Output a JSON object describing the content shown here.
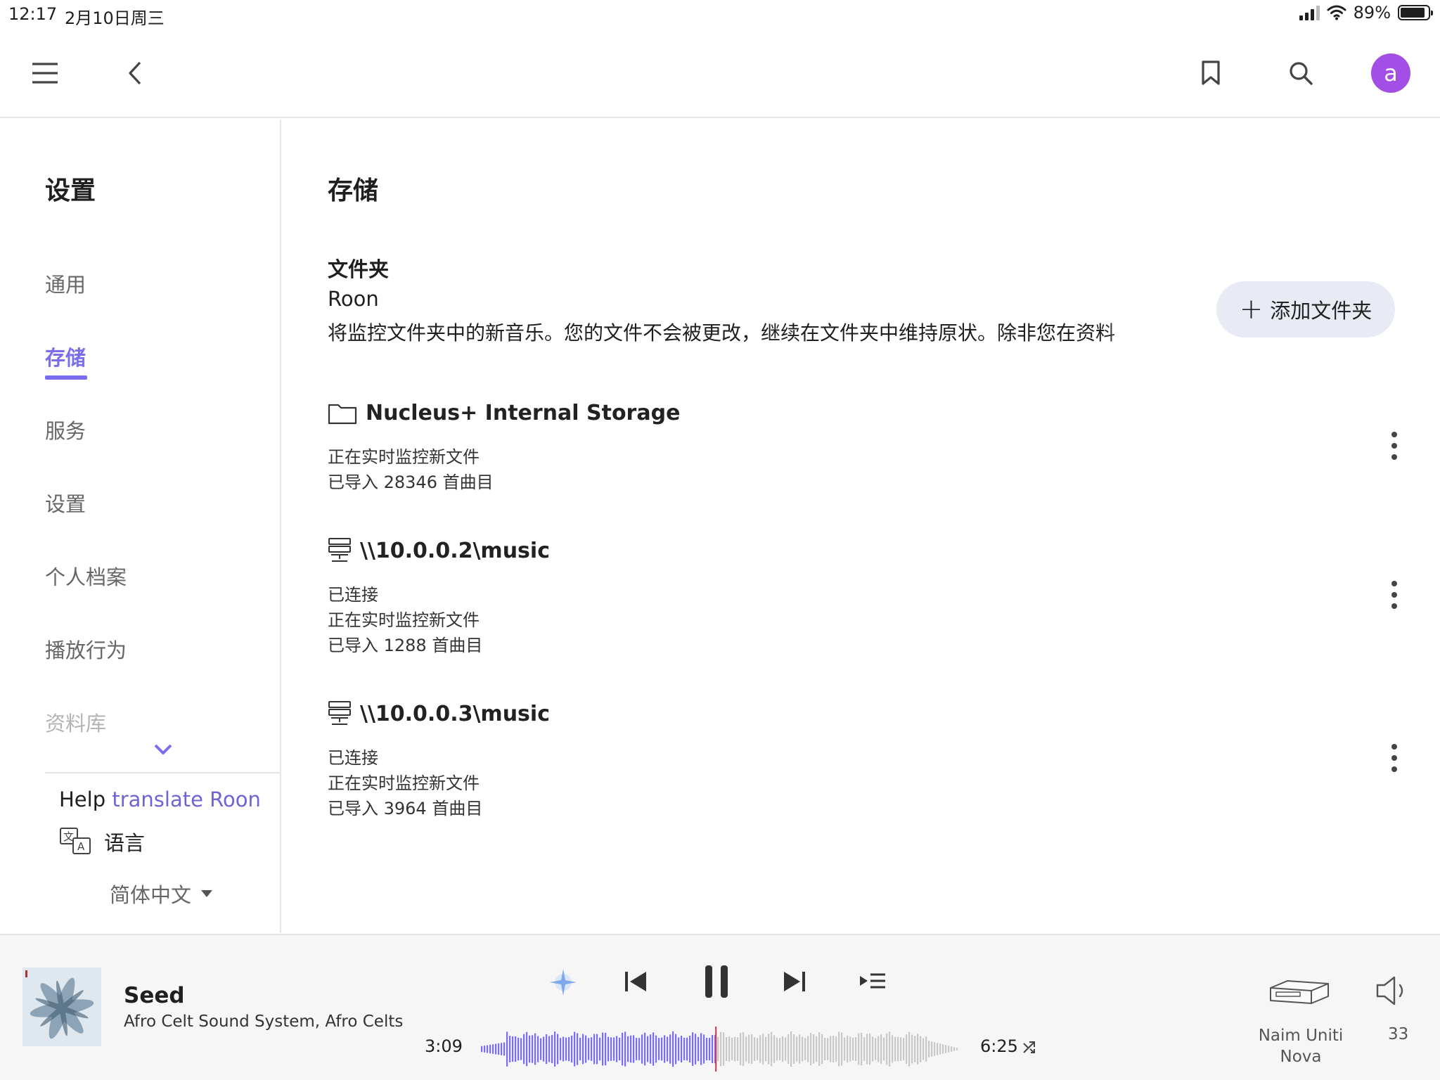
{
  "status_bar": {
    "time": "12:17",
    "date": "2月10日周三",
    "battery": "89%"
  },
  "top_nav": {
    "avatar_letter": "a"
  },
  "sidebar": {
    "title": "设置",
    "items": [
      {
        "label": "通用"
      },
      {
        "label": "存储"
      },
      {
        "label": "服务"
      },
      {
        "label": "设置"
      },
      {
        "label": "个人档案"
      },
      {
        "label": "播放行为"
      },
      {
        "label": "资料库"
      }
    ],
    "active_index": 1,
    "help_text": "Help",
    "help_link": "translate Roon",
    "language_label": "语言",
    "language_value": "简体中文"
  },
  "main": {
    "title": "存储",
    "folder_heading": "文件夹",
    "folder_sub": "Roon",
    "folder_desc": "将监控文件夹中的新音乐。您的文件不会被更改，继续在文件夹中维持原状。除非您在资料",
    "add_folder_label": "添加文件夹",
    "storages": [
      {
        "name": "Nucleus+ Internal Storage",
        "icon": "folder-icon",
        "lines": [
          "正在实时监控新文件",
          "已导入 28346 首曲目"
        ]
      },
      {
        "name": "\\\\10.0.0.2\\music",
        "icon": "network-drive-icon",
        "lines": [
          "已连接",
          "正在实时监控新文件",
          "已导入 1288 首曲目"
        ]
      },
      {
        "name": "\\\\10.0.0.3\\music",
        "icon": "network-drive-icon",
        "lines": [
          "已连接",
          "正在实时监控新文件",
          "已导入 3964 首曲目"
        ]
      }
    ]
  },
  "player": {
    "track_title": "Seed",
    "track_artist": "Afro Celt Sound System, Afro Celts",
    "time_elapsed": "3:09",
    "time_total": "6:25",
    "progress_fraction": 0.49,
    "zone_name": "Naim Uniti Nova",
    "volume": "33",
    "accent_color": "#7a6ef0"
  }
}
